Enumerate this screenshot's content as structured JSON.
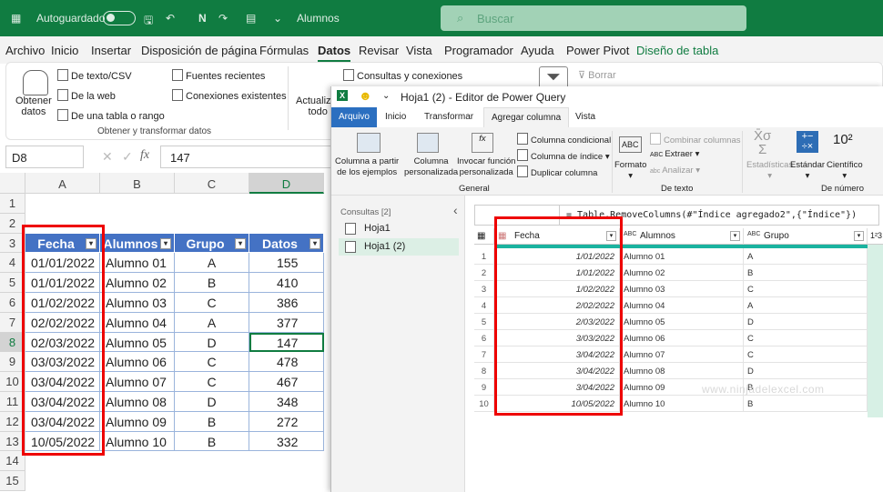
{
  "excel": {
    "titlebar": {
      "autosave": "Autoguardado",
      "quick_n": "N",
      "workbook": "Alumnos",
      "search_placeholder": "Buscar"
    },
    "tabs": [
      "Archivo",
      "Inicio",
      "Insertar",
      "Disposición de página",
      "Fórmulas",
      "Datos",
      "Revisar",
      "Vista",
      "Programador",
      "Ayuda",
      "Power Pivot",
      "Diseño de tabla"
    ],
    "active_tab": "Datos",
    "ribbon": {
      "get_data": "Obtener",
      "get_data2": "datos",
      "text_csv": "De texto/CSV",
      "web": "De la web",
      "table_range": "De una tabla o rango",
      "recent": "Fuentes recientes",
      "existing": "Conexiones existentes",
      "group_label": "Obtener y transformar datos",
      "refresh": "Actualizar",
      "refresh2": "todo",
      "queries": "Consultas y conexiones",
      "clear": "Borrar"
    },
    "name_box": "D8",
    "formula_value": "147",
    "columns": [
      "A",
      "B",
      "C",
      "D"
    ],
    "row_numbers": [
      "1",
      "2",
      "3",
      "4",
      "5",
      "6",
      "7",
      "8",
      "9",
      "10",
      "11",
      "12",
      "13",
      "14",
      "15"
    ],
    "headers": [
      "Fecha",
      "Alumnos",
      "Grupo",
      "Datos"
    ],
    "rows": [
      [
        "01/01/2022",
        "Alumno 01",
        "A",
        "155"
      ],
      [
        "01/01/2022",
        "Alumno 02",
        "B",
        "410"
      ],
      [
        "01/02/2022",
        "Alumno 03",
        "C",
        "386"
      ],
      [
        "02/02/2022",
        "Alumno 04",
        "A",
        "377"
      ],
      [
        "02/03/2022",
        "Alumno 05",
        "D",
        "147"
      ],
      [
        "03/03/2022",
        "Alumno 06",
        "C",
        "478"
      ],
      [
        "03/04/2022",
        "Alumno 07",
        "C",
        "467"
      ],
      [
        "03/04/2022",
        "Alumno 08",
        "D",
        "348"
      ],
      [
        "03/04/2022",
        "Alumno 09",
        "B",
        "272"
      ],
      [
        "10/05/2022",
        "Alumno 10",
        "B",
        "332"
      ]
    ]
  },
  "power_query": {
    "title": "Hoja1 (2) - Editor de Power Query",
    "tabs": [
      "Arquivo",
      "Inicio",
      "Transformar",
      "Agregar columna",
      "Vista"
    ],
    "active_tab": "Agregar columna",
    "ribbon": {
      "col_examples": "Columna a partir",
      "col_examples2": "de los ejemplos",
      "custom_col": "Columna",
      "custom_col2": "personalizada",
      "invoke": "Invocar función",
      "invoke2": "personalizada",
      "conditional": "Columna condicional",
      "index": "Columna de índice",
      "duplicate": "Duplicar columna",
      "general": "General",
      "format": "Formato",
      "merge": "Combinar columnas",
      "extract": "Extraer",
      "parse": "Analizar",
      "text_group": "De texto",
      "stats": "Estadísticas",
      "standard": "Estándar",
      "scientific": "Científico",
      "number_group": "De número"
    },
    "queries_label": "Consultas [2]",
    "queries": [
      "Hoja1",
      "Hoja1 (2)"
    ],
    "formula": "= Table.RemoveColumns(#\"Índice agregado2\",{\"Índice\"})",
    "headers": [
      "Fecha",
      "Alumnos",
      "Grupo"
    ],
    "rows": [
      [
        "1/01/2022",
        "Alumno 01",
        "A"
      ],
      [
        "1/01/2022",
        "Alumno 02",
        "B"
      ],
      [
        "1/02/2022",
        "Alumno 03",
        "C"
      ],
      [
        "2/02/2022",
        "Alumno 04",
        "A"
      ],
      [
        "2/03/2022",
        "Alumno 05",
        "D"
      ],
      [
        "3/03/2022",
        "Alumno 06",
        "C"
      ],
      [
        "3/04/2022",
        "Alumno 07",
        "C"
      ],
      [
        "3/04/2022",
        "Alumno 08",
        "D"
      ],
      [
        "3/04/2022",
        "Alumno 09",
        "B"
      ],
      [
        "10/05/2022",
        "Alumno 10",
        "B"
      ]
    ],
    "watermark": "www.ninjadelexcel.com"
  },
  "colors": {
    "excel_green": "#107c41",
    "table_header": "#4472c4",
    "highlight": "#e00000",
    "pq_accent": "#1ab39f"
  }
}
